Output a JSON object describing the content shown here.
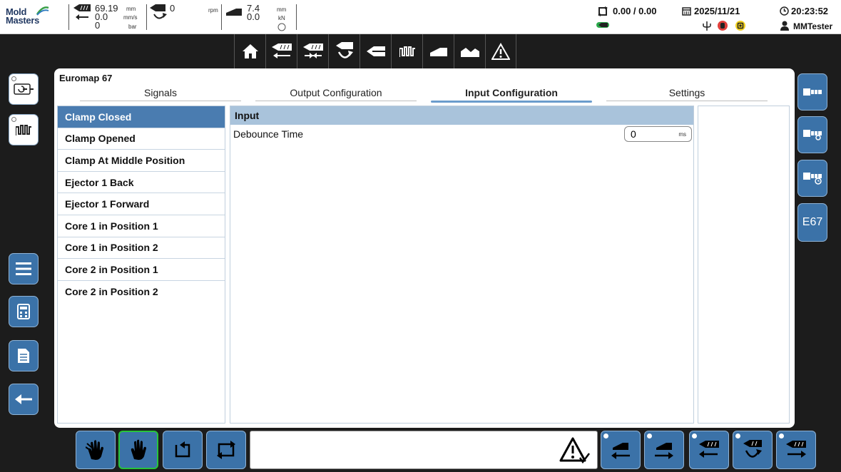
{
  "status_bar": {
    "logo_line1": "Mold",
    "logo_line2": "Masters",
    "injection_position": "69.19",
    "injection_position_unit": "mm",
    "injection_speed": "0.0",
    "injection_speed_unit": "mm/s",
    "injection_pressure": "0",
    "injection_pressure_unit": "bar",
    "screw_rpm": "0",
    "screw_rpm_unit": "rpm",
    "clamp_position": "7.4",
    "clamp_position_unit": "mm",
    "clamp_force": "0.0",
    "clamp_force_unit": "kN",
    "cycle_counter": "0.00 / 0.00",
    "date": "2025/11/21",
    "time": "20:23:52",
    "user": "MMTester"
  },
  "nav_bar": {
    "items": [
      "home",
      "injection",
      "hold",
      "screw",
      "nozzle",
      "heating",
      "clamp",
      "statistics",
      "alarm"
    ]
  },
  "side_left": {
    "items": [
      "ejector-panel",
      "temperature-panel",
      "menu",
      "calculator",
      "document",
      "back"
    ]
  },
  "side_right": {
    "items": [
      "core-panel",
      "core-settings",
      "core-timer"
    ],
    "e67_label": "E67"
  },
  "main": {
    "title": "Euromap 67",
    "tabs": [
      {
        "label": "Signals",
        "active": false
      },
      {
        "label": "Output Configuration",
        "active": false
      },
      {
        "label": "Input Configuration",
        "active": true
      },
      {
        "label": "Settings",
        "active": false
      }
    ],
    "signals": [
      "Clamp Closed",
      "Clamp Opened",
      "Clamp At Middle Position",
      "Ejector 1 Back",
      "Ejector 1 Forward",
      "Core 1 in Position 1",
      "Core 1 in Position 2",
      "Core 2 in Position 1",
      "Core 2 in Position 2"
    ],
    "selected_signal": "Clamp Closed",
    "detail": {
      "group_title": "Input",
      "debounce_label": "Debounce Time",
      "debounce_value": "0",
      "debounce_unit": "ms"
    }
  },
  "bottom_bar": {
    "modes": [
      "manual-setup",
      "manual",
      "semi-auto",
      "auto-cycle"
    ],
    "active_mode": "manual",
    "actions": [
      "core-in",
      "core-out",
      "injection-back",
      "screw-rotate",
      "injection-forward"
    ]
  },
  "colors": {
    "accent_blue": "#3b72a8",
    "selected_row": "#4a7cb0",
    "group_header": "#a9c3db",
    "active_mode_border": "#27c43a",
    "background_dark": "#1c1c1c"
  }
}
